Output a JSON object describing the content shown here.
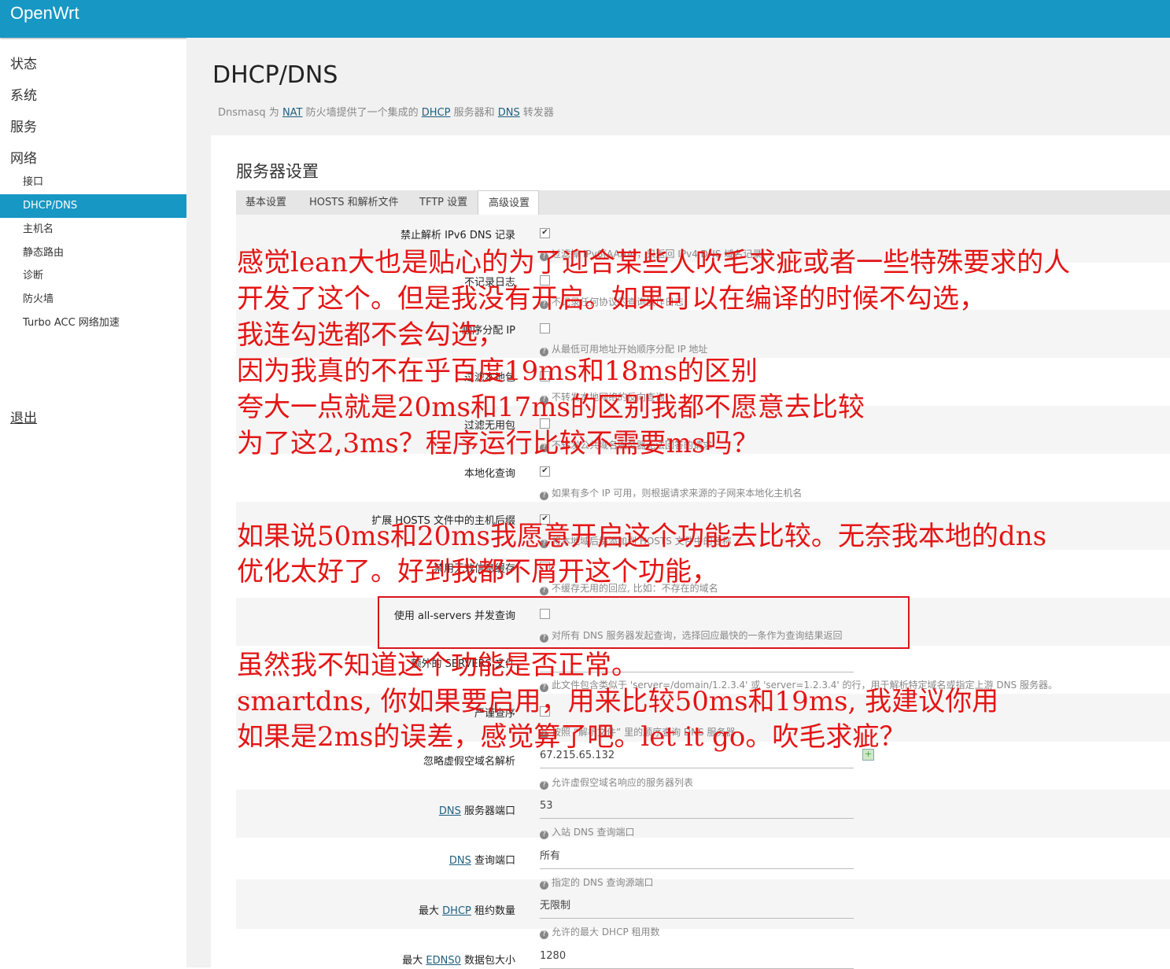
{
  "app": {
    "brand": "OpenWrt"
  },
  "sidebar": {
    "top_items": [
      "状态",
      "系统",
      "服务",
      "网络"
    ],
    "sub_items": [
      "接口",
      "DHCP/DNS",
      "主机名",
      "静态路由",
      "诊断",
      "防火墙",
      "Turbo ACC 网络加速"
    ],
    "active_sub": "DHCP/DNS",
    "logout": "退出"
  },
  "page": {
    "title": "DHCP/DNS",
    "desc_parts": [
      "Dnsmasq 为 ",
      "NAT",
      " 防火墙提供了一个集成的 ",
      "DHCP",
      " 服务器和 ",
      "DNS",
      " 转发器"
    ]
  },
  "section": {
    "title": "服务器设置"
  },
  "tabs": [
    "基本设置",
    "HOSTS 和解析文件",
    "TFTP 设置",
    "高级设置"
  ],
  "active_tab": "高级设置",
  "rows": [
    {
      "label": "禁止解析 IPv6 DNS 记录",
      "checked": true,
      "help": "过滤掉 IPv6(AAAA)，只返回 IPv4 DNS 域名记录"
    },
    {
      "label": "不记录日志",
      "checked": false,
      "help": "不记录任何协议的查询操作日志"
    },
    {
      "label": "顺序分配 IP",
      "checked": false,
      "help": "从最低可用地址开始顺序分配 IP 地址"
    },
    {
      "label": "过滤本地包",
      "checked": false,
      "help": "不转发本地网络的反向查询"
    },
    {
      "label": "过滤无用包",
      "checked": false,
      "help": "不转发公共域名服务器无法回答的请求"
    },
    {
      "label": "本地化查询",
      "checked": true,
      "help": "如果有多个 IP 可用，则根据请求来源的子网来本地化主机名"
    },
    {
      "label": "扩展 HOSTS 文件中的主机后缀",
      "checked": true,
      "help": "将本地域后缀添加到 HOSTS 文件中的名称"
    },
    {
      "label": "禁用无效信息缓存",
      "checked": false,
      "help": "不缓存无用的回应, 比如：不存在的域名"
    },
    {
      "label": "使用 all-servers 并发查询",
      "checked": false,
      "help": "对所有 DNS 服务器发起查询，选择回应最快的一条作为查询结果返回"
    },
    {
      "label": "额外的 SERVERS 文件",
      "checked": null,
      "help": "此文件包含类似于 'server=/domain/1.2.3.4' 或 'server=1.2.3.4' 的行，用于解析特定域名或指定上游 DNS 服务器。"
    },
    {
      "label": "严谨查序",
      "checked": false,
      "help": "按照 “解析文件” 里的顺序查询 DNS 服务器"
    }
  ],
  "inputs": [
    {
      "label": "忽略虚假空域名解析",
      "value": "67.215.65.132",
      "help": "允许虚假空域名响应的服务器列表"
    },
    {
      "label_link": "DNS",
      "label": " 服务器端口",
      "value": "53",
      "help": "入站 DNS 查询端口"
    },
    {
      "label_link": "DNS",
      "label": " 查询端口",
      "value": "所有",
      "help": "指定的 DNS 查询源端口"
    },
    {
      "label_pre": "最大 ",
      "label_link": "DHCP",
      "label": " 租约数量",
      "value": "无限制",
      "help": "允许的最大 DHCP 租用数"
    },
    {
      "label_pre": "最大 ",
      "label_link": "EDNS0",
      "label": " 数据包大小",
      "value": "1280",
      "help": ""
    }
  ],
  "annotations": [
    "感觉lean大也是贴心的为了迎合某些人吹毛求疵或者一些特殊要求的人",
    "开发了这个。但是我没有开启。如果可以在编译的时候不勾选，",
    "我连勾选都不会勾选，",
    "因为我真的不在乎百度19ms和18ms的区别",
    "夸大一点就是20ms和17ms的区别我都不愿意去比较",
    "为了这2,3ms？程序运行比较不需要ms吗？",
    "如果说50ms和20ms我愿意开启这个功能去比较。无奈我本地的dns",
    "优化太好了。好到我都不屑开这个功能，",
    "虽然我不知道这个功能是否正常。",
    "smartdns, 你如果要启用，用来比较50ms和19ms, 我建议你用",
    "如果是2ms的误差，感觉算了吧。let it go。吹毛求疵？"
  ],
  "colors": {
    "brand_bar": "#1797c4",
    "annotation": "#e41515",
    "highlight_box": "#d8141b"
  }
}
